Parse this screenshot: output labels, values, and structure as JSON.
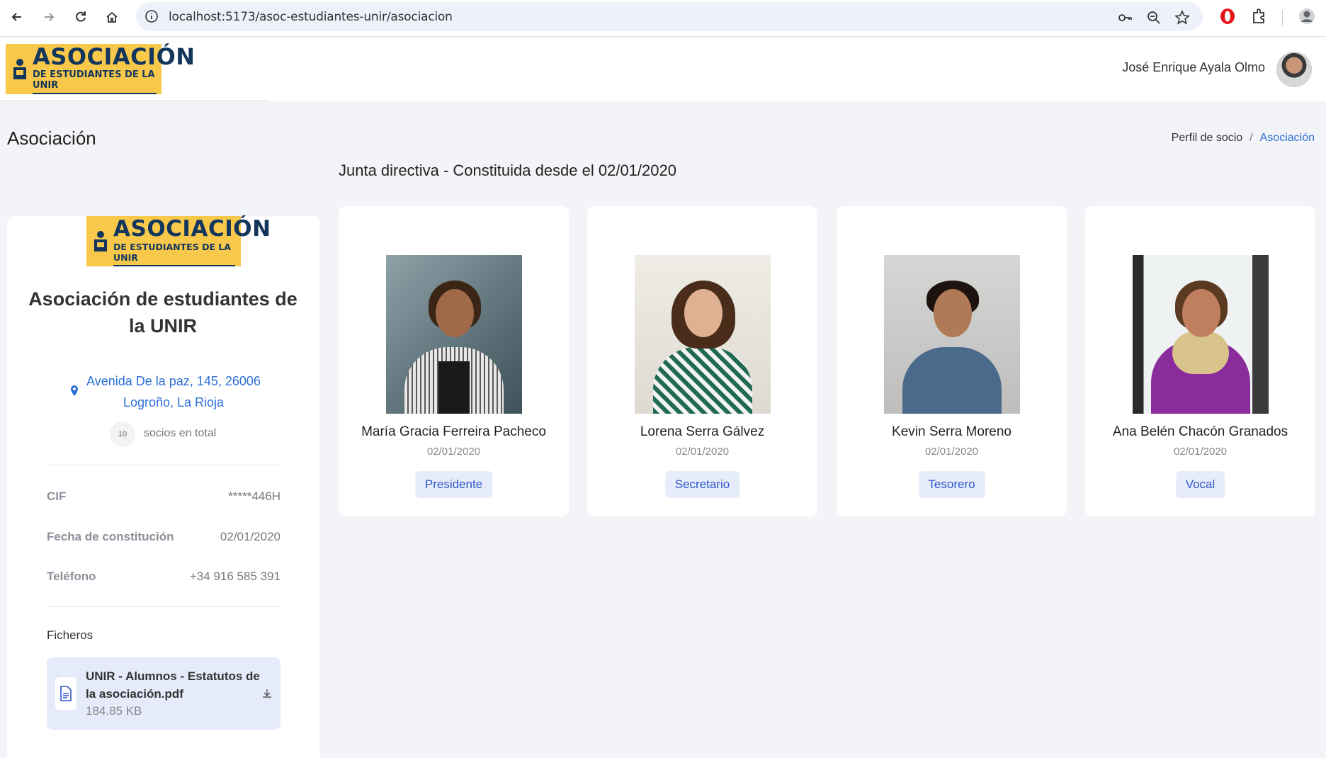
{
  "browser": {
    "url": "localhost:5173/asoc-estudiantes-unir/asociacion"
  },
  "header": {
    "logo": {
      "line1": "ASOCIACIÓN",
      "line2": "DE ESTUDIANTES DE LA UNIR"
    },
    "user_name": "José Enrique Ayala Olmo"
  },
  "page": {
    "title": "Asociación",
    "breadcrumb": [
      "Perfil de socio",
      "Asociación"
    ]
  },
  "association": {
    "logo": {
      "line1": "ASOCIACIÓN",
      "line2": "DE ESTUDIANTES DE LA UNIR"
    },
    "name": "Asociación de estudiantes de la UNIR",
    "address_line1": "Avenida De la paz, 145, 26006",
    "address_line2": "Logroño, La Rioja",
    "members_count": "10",
    "members_label": "socios en total",
    "details": [
      {
        "label": "CIF",
        "value": "*****446H"
      },
      {
        "label": "Fecha de constitución",
        "value": "02/01/2020"
      },
      {
        "label": "Teléfono",
        "value": "+34 916 585 391"
      }
    ],
    "files_title": "Ficheros",
    "files": [
      {
        "name": "UNIR - Alumnos - Estatutos de la asociación.pdf",
        "size": "184.85 KB"
      }
    ]
  },
  "board": {
    "title": "Junta directiva - Constituida desde el 02/01/2020",
    "members": [
      {
        "name": "María Gracia Ferreira Pacheco",
        "date": "02/01/2020",
        "role": "Presidente"
      },
      {
        "name": "Lorena Serra Gálvez",
        "date": "02/01/2020",
        "role": "Secretario"
      },
      {
        "name": "Kevin Serra Moreno",
        "date": "02/01/2020",
        "role": "Tesorero"
      },
      {
        "name": "Ana Belén Chacón Granados",
        "date": "02/01/2020",
        "role": "Vocal"
      }
    ]
  },
  "colors": {
    "accent": "#2c6fd6",
    "logo_yellow": "#f8c84b",
    "logo_navy": "#13365c",
    "chip_bg": "#e7ecfb",
    "page_bg": "#f3f4f7"
  }
}
